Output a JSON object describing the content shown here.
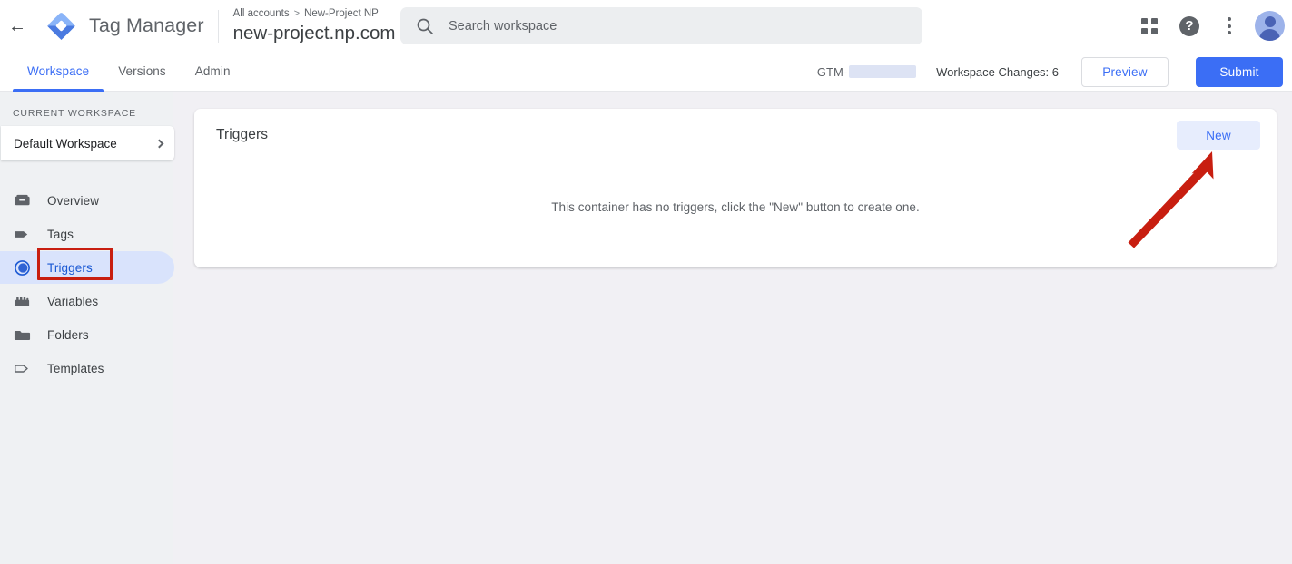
{
  "header": {
    "back_icon": "back-arrow-icon",
    "logo_icon": "tag-manager-logo-icon",
    "product_title": "Tag Manager",
    "breadcrumb": {
      "account": "All accounts",
      "separator": ">",
      "project": "New-Project NP"
    },
    "container_name": "new-project.np.com",
    "container_dropdown_icon": "chevron-down-icon",
    "search": {
      "icon": "search-icon",
      "placeholder": "Search workspace",
      "value": ""
    },
    "actions": {
      "apps_icon": "apps-grid-icon",
      "help_icon": "help-question-icon",
      "help_glyph": "?",
      "more_icon": "more-vertical-icon",
      "avatar_icon": "user-avatar-icon"
    }
  },
  "nav": {
    "tabs": [
      {
        "label": "Workspace",
        "active": true
      },
      {
        "label": "Versions",
        "active": false
      },
      {
        "label": "Admin",
        "active": false
      }
    ],
    "gtm_id_prefix": "GTM-",
    "gtm_id_redacted": true,
    "workspace_changes": "Workspace Changes: 6",
    "preview_label": "Preview",
    "submit_label": "Submit"
  },
  "sidebar": {
    "section_label": "CURRENT WORKSPACE",
    "workspace_name": "Default Workspace",
    "workspace_chevron_icon": "chevron-right-icon",
    "items": [
      {
        "label": "Overview",
        "icon": "overview-box-icon",
        "selected": false
      },
      {
        "label": "Tags",
        "icon": "tag-icon",
        "selected": false
      },
      {
        "label": "Triggers",
        "icon": "trigger-circle-icon",
        "selected": true
      },
      {
        "label": "Variables",
        "icon": "variables-block-icon",
        "selected": false
      },
      {
        "label": "Folders",
        "icon": "folder-icon",
        "selected": false
      },
      {
        "label": "Templates",
        "icon": "template-tag-outline-icon",
        "selected": false
      }
    ]
  },
  "main": {
    "card_title": "Triggers",
    "new_button_label": "New",
    "empty_message": "This container has no triggers, click the \"New\" button to create one."
  },
  "annotations": {
    "highlight_rect_target": "Triggers",
    "arrow_target": "New",
    "color": "#c81e10"
  },
  "colors": {
    "accent_blue": "#3b6ef5",
    "selected_pill": "#d9e3fc",
    "selected_text": "#1b59d4",
    "page_bg": "#f1f0f4",
    "sidebar_bg": "#eff1f3",
    "annotation_red": "#c81e10"
  }
}
